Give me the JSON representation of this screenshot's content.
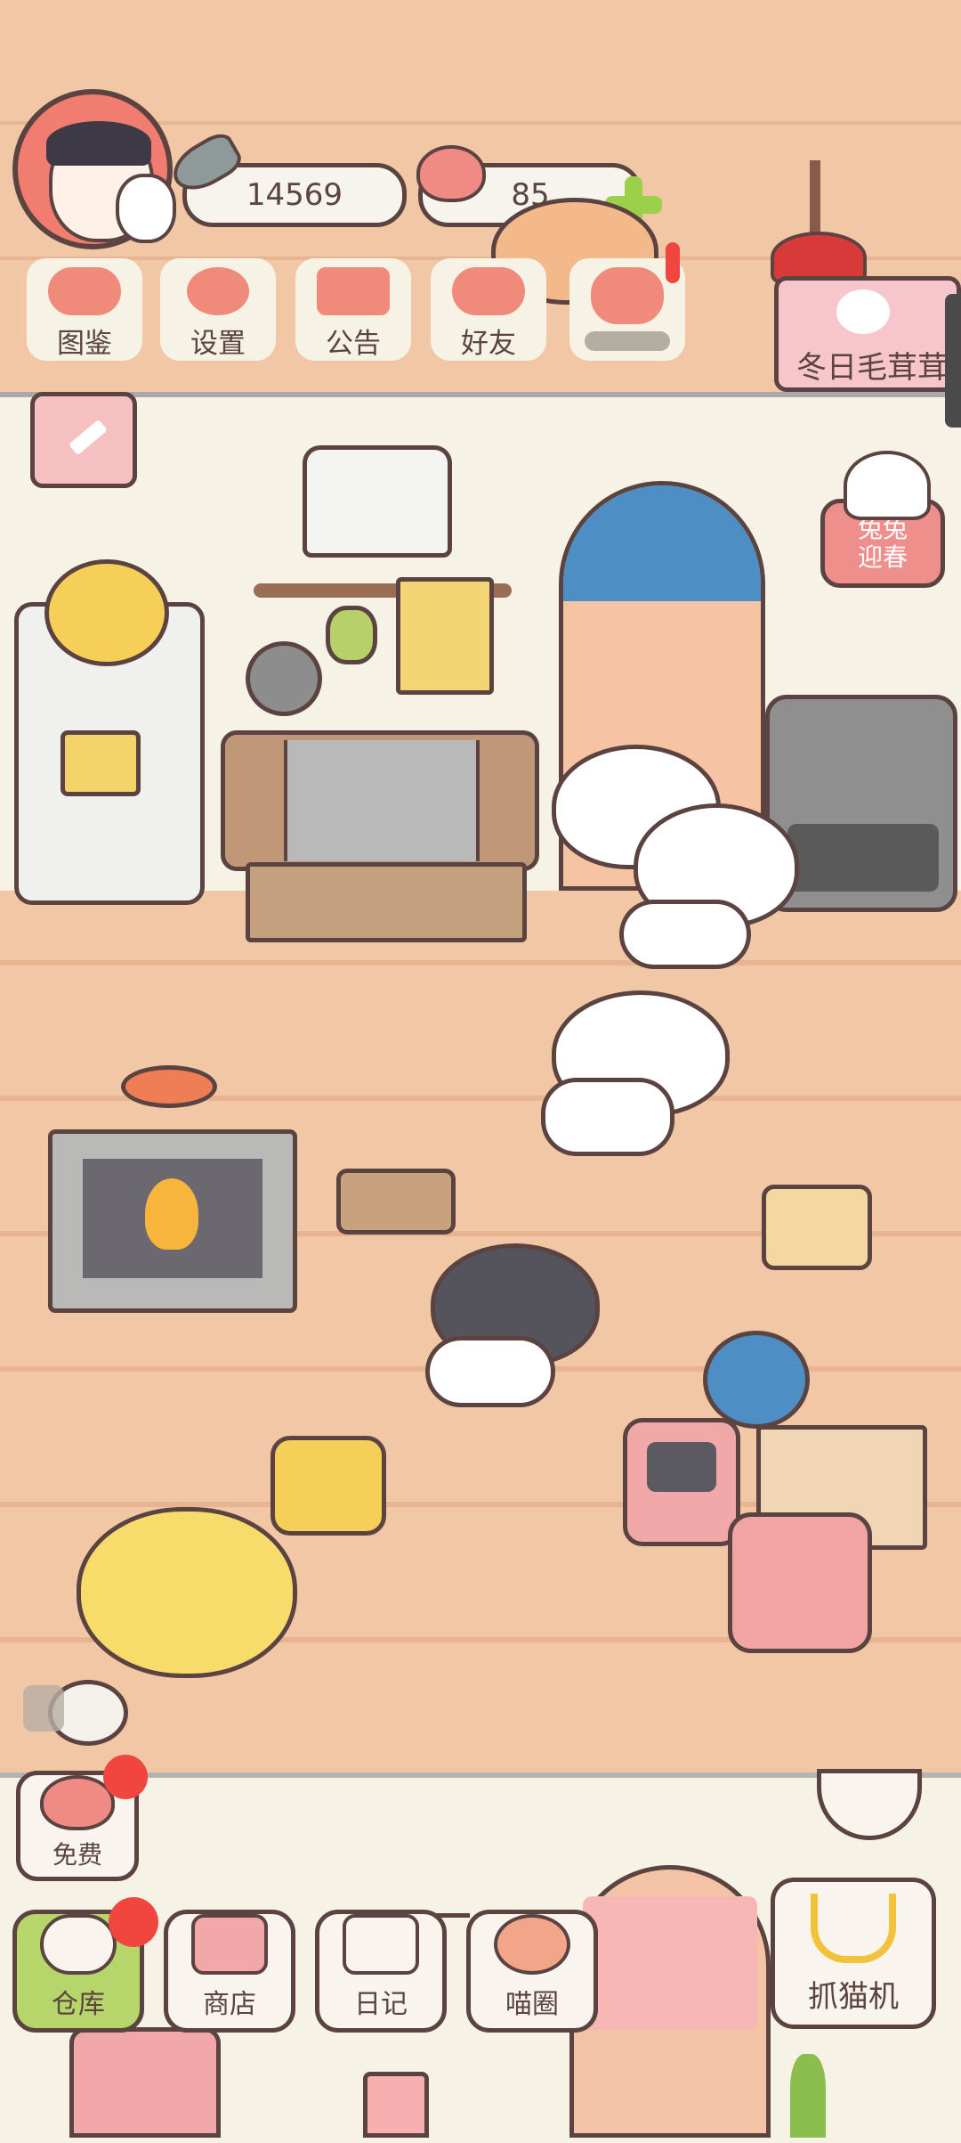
{
  "hud": {
    "coins": "14569",
    "hearts": "85"
  },
  "top_menu": [
    {
      "label": "图鉴",
      "icon": "cat-face-icon"
    },
    {
      "label": "设置",
      "icon": "gear-icon"
    },
    {
      "label": "公告",
      "icon": "gift-icon"
    },
    {
      "label": "好友",
      "icon": "friends-icon"
    }
  ],
  "event_banner": {
    "label": "冬日毛茸茸"
  },
  "event_badge": {
    "line1": "兔兔",
    "line2": "迎春"
  },
  "free_button": {
    "label": "免费"
  },
  "bottom_menu": [
    {
      "label": "仓库",
      "icon": "warehouse-icon"
    },
    {
      "label": "商店",
      "icon": "shop-icon"
    },
    {
      "label": "日记",
      "icon": "diary-icon"
    },
    {
      "label": "喵圈",
      "icon": "planet-cat-icon"
    }
  ],
  "claw_machine": {
    "label": "抓猫机"
  },
  "colors": {
    "accent_red": "#f0463f",
    "green_plus": "#9bd14a",
    "outline": "#5a4340",
    "warehouse_green": "#b6d66c"
  }
}
